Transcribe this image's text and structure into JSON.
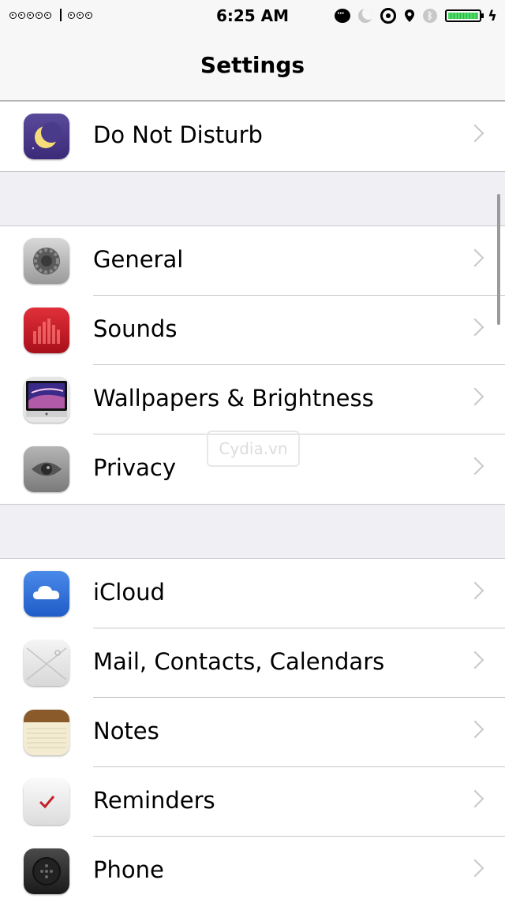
{
  "status_bar": {
    "time": "6:25 AM",
    "carrier_dots": 5,
    "wifi_dots": 3,
    "icons": [
      "message-icon",
      "moon-icon",
      "rotation-lock-icon",
      "location-icon",
      "bluetooth-icon",
      "battery-icon",
      "charging-bolt-icon"
    ],
    "battery_level": 1.0
  },
  "nav": {
    "title": "Settings"
  },
  "groups": [
    {
      "rows": [
        {
          "label": "Do Not Disturb",
          "icon": "do-not-disturb-icon"
        }
      ]
    },
    {
      "rows": [
        {
          "label": "General",
          "icon": "gear-icon"
        },
        {
          "label": "Sounds",
          "icon": "sounds-icon"
        },
        {
          "label": "Wallpapers & Brightness",
          "icon": "wallpaper-icon"
        },
        {
          "label": "Privacy",
          "icon": "privacy-eye-icon"
        }
      ]
    },
    {
      "rows": [
        {
          "label": "iCloud",
          "icon": "icloud-icon"
        },
        {
          "label": "Mail, Contacts, Calendars",
          "icon": "mail-icon"
        },
        {
          "label": "Notes",
          "icon": "notes-icon"
        },
        {
          "label": "Reminders",
          "icon": "reminders-icon"
        },
        {
          "label": "Phone",
          "icon": "phone-icon"
        }
      ]
    }
  ],
  "watermark": {
    "text": "Cydia.vn"
  },
  "colors": {
    "background": "#efeff4",
    "separator": "#c8c7cc",
    "chevron": "#c7c7cc",
    "battery": "#4cd964"
  }
}
